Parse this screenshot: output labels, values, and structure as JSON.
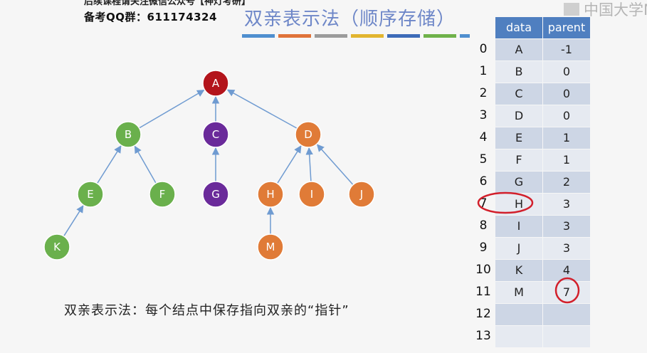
{
  "header": {
    "cut_line": "后续课程请关注微信公众号【神灯考研】",
    "qq_line": "备考QQ群：611174324"
  },
  "title": "双亲表示法（顺序存储）",
  "title_bar_colors": [
    "#4f8fcf",
    "#e0733a",
    "#9b9b9b",
    "#e2b52f",
    "#3d6bb8",
    "#6fb24a",
    "#4f8fcf"
  ],
  "logo": {
    "text": "中国大学M",
    "icon": "mooc-logo-icon"
  },
  "tree": {
    "colors": {
      "root": "#b3141b",
      "green": "#6ab04c",
      "purple": "#6a2a9a",
      "orange": "#e07b37",
      "edge": "#6f9bd1"
    },
    "nodes": [
      {
        "id": "A",
        "color": "root"
      },
      {
        "id": "B",
        "color": "green"
      },
      {
        "id": "C",
        "color": "purple"
      },
      {
        "id": "D",
        "color": "orange"
      },
      {
        "id": "E",
        "color": "green"
      },
      {
        "id": "F",
        "color": "green"
      },
      {
        "id": "G",
        "color": "purple"
      },
      {
        "id": "H",
        "color": "orange"
      },
      {
        "id": "I",
        "color": "orange"
      },
      {
        "id": "J",
        "color": "orange"
      },
      {
        "id": "K",
        "color": "green"
      },
      {
        "id": "M",
        "color": "orange"
      }
    ],
    "edges": [
      [
        "B",
        "A"
      ],
      [
        "C",
        "A"
      ],
      [
        "D",
        "A"
      ],
      [
        "E",
        "B"
      ],
      [
        "F",
        "B"
      ],
      [
        "G",
        "C"
      ],
      [
        "H",
        "D"
      ],
      [
        "I",
        "D"
      ],
      [
        "J",
        "D"
      ],
      [
        "K",
        "E"
      ],
      [
        "M",
        "H"
      ]
    ]
  },
  "caption": "双亲表示法：每个结点中保存指向双亲的“指针”",
  "table": {
    "headers": {
      "data": "data",
      "parent": "parent"
    },
    "rows": [
      {
        "index": "0",
        "data": "A",
        "parent": "-1"
      },
      {
        "index": "1",
        "data": "B",
        "parent": "0"
      },
      {
        "index": "2",
        "data": "C",
        "parent": "0"
      },
      {
        "index": "3",
        "data": "D",
        "parent": "0"
      },
      {
        "index": "4",
        "data": "E",
        "parent": "1"
      },
      {
        "index": "5",
        "data": "F",
        "parent": "1"
      },
      {
        "index": "6",
        "data": "G",
        "parent": "2"
      },
      {
        "index": "7",
        "data": "H",
        "parent": "3"
      },
      {
        "index": "8",
        "data": "I",
        "parent": "3"
      },
      {
        "index": "9",
        "data": "J",
        "parent": "3"
      },
      {
        "index": "10",
        "data": "K",
        "parent": "4"
      },
      {
        "index": "11",
        "data": "M",
        "parent": "7"
      },
      {
        "index": "12",
        "data": "",
        "parent": ""
      },
      {
        "index": "13",
        "data": "",
        "parent": ""
      }
    ]
  },
  "annotation_color": "#d21f2b"
}
